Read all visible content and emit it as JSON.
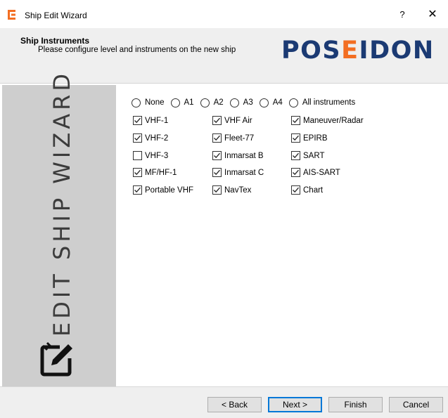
{
  "window": {
    "title": "Ship Edit Wizard",
    "help_label": "?",
    "close_label": "✕"
  },
  "header": {
    "title": "Ship Instruments",
    "subtitle": "Please configure level and instruments on the new ship",
    "logo_part1": "POS",
    "logo_part2": "E",
    "logo_part3": "IDON",
    "logo_color": "#1b3a73",
    "accent_color": "#f36e22"
  },
  "sidebar": {
    "label": "EDIT SHIP WIZARD",
    "icon": "pencil-edit-icon"
  },
  "levels": [
    {
      "label": "None",
      "selected": false
    },
    {
      "label": "A1",
      "selected": false
    },
    {
      "label": "A2",
      "selected": false
    },
    {
      "label": "A3",
      "selected": false
    },
    {
      "label": "A4",
      "selected": false
    },
    {
      "label": "All instruments",
      "selected": false
    }
  ],
  "instruments": {
    "col1": [
      {
        "label": "VHF-1",
        "checked": true
      },
      {
        "label": "VHF-2",
        "checked": true
      },
      {
        "label": "VHF-3",
        "checked": false
      },
      {
        "label": "MF/HF-1",
        "checked": true
      },
      {
        "label": "Portable VHF",
        "checked": true
      }
    ],
    "col2": [
      {
        "label": "VHF Air",
        "checked": true
      },
      {
        "label": "Fleet-77",
        "checked": true
      },
      {
        "label": "Inmarsat B",
        "checked": true
      },
      {
        "label": "Inmarsat C",
        "checked": true
      },
      {
        "label": "NavTex",
        "checked": true
      }
    ],
    "col3": [
      {
        "label": "Maneuver/Radar",
        "checked": true
      },
      {
        "label": "EPIRB",
        "checked": true
      },
      {
        "label": "SART",
        "checked": true
      },
      {
        "label": "AIS-SART",
        "checked": true
      },
      {
        "label": "Chart",
        "checked": true
      }
    ]
  },
  "footer": {
    "back_label": "< Back",
    "next_label": "Next >",
    "finish_label": "Finish",
    "cancel_label": "Cancel"
  }
}
